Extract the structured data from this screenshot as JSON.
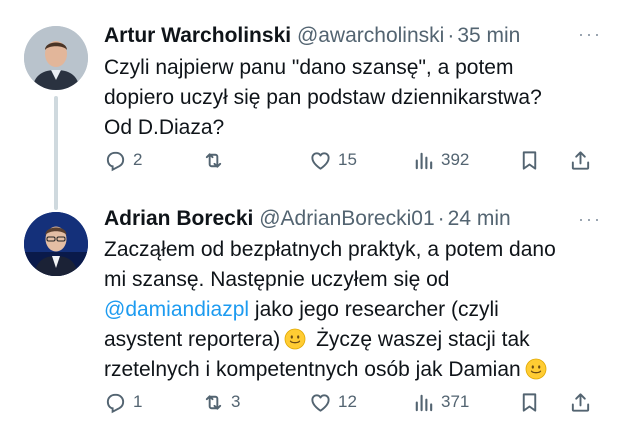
{
  "tweets": [
    {
      "author_name": "Artur Warcholinski",
      "handle": "@awarcholinski",
      "time": "35 min",
      "text_lines": [
        "Czyli najpierw panu \"dano szansę\", a potem",
        "dopiero uczył się pan podstaw dziennikarstwa?",
        "Od D.Diaza?"
      ],
      "replies": "2",
      "retweets": "",
      "likes": "15",
      "views": "392"
    },
    {
      "author_name": "Adrian Borecki",
      "handle": "@AdrianBorecki01",
      "time": "24 min",
      "text_lines": [
        "Zacząłem od bezpłatnych praktyk, a potem dano",
        "mi szansę. Następnie uczyłem się od",
        "@damiandiazpl",
        " jako jego researcher (czyli",
        "asystent reportera)",
        " Życzę waszej stacji tak",
        "rzetelnych i kompetentnych osób jak Damian"
      ],
      "replies": "1",
      "retweets": "3",
      "likes": "12",
      "views": "371"
    }
  ],
  "separator": "·",
  "more_label": "···",
  "icons": [
    "reply-icon",
    "retweet-icon",
    "like-icon",
    "views-icon",
    "bookmark-icon",
    "share-icon",
    "slightly-smiling-face-emoji"
  ],
  "colors": {
    "text": "#0f1419",
    "secondary": "#536471",
    "link": "#1d9bf0",
    "thread_line": "#cfd9de"
  }
}
